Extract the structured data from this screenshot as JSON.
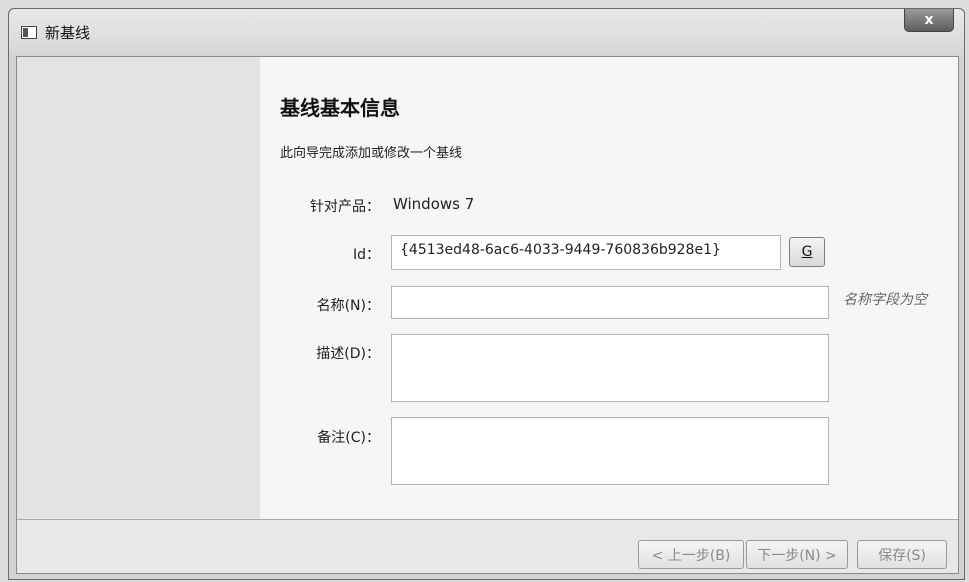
{
  "window": {
    "title": "新基线",
    "close_glyph": "x"
  },
  "heading": "基线基本信息",
  "subtitle": "此向导完成添加或修改一个基线",
  "form": {
    "product_label": "针对产品：",
    "product_value": "Windows 7",
    "id_label": "Id：",
    "id_value": "{4513ed48-6ac6-4033-9449-760836b928e1}",
    "generate_button": "G",
    "name_label": "名称(N)：",
    "name_value": "",
    "name_warning": "名称字段为空",
    "desc_label": "描述(D)：",
    "desc_value": "",
    "note_label": "备注(C)：",
    "note_value": ""
  },
  "footer": {
    "back_button": "< 上一步(B)",
    "next_button": "下一步(N) >",
    "save_button": "保存(S)"
  }
}
